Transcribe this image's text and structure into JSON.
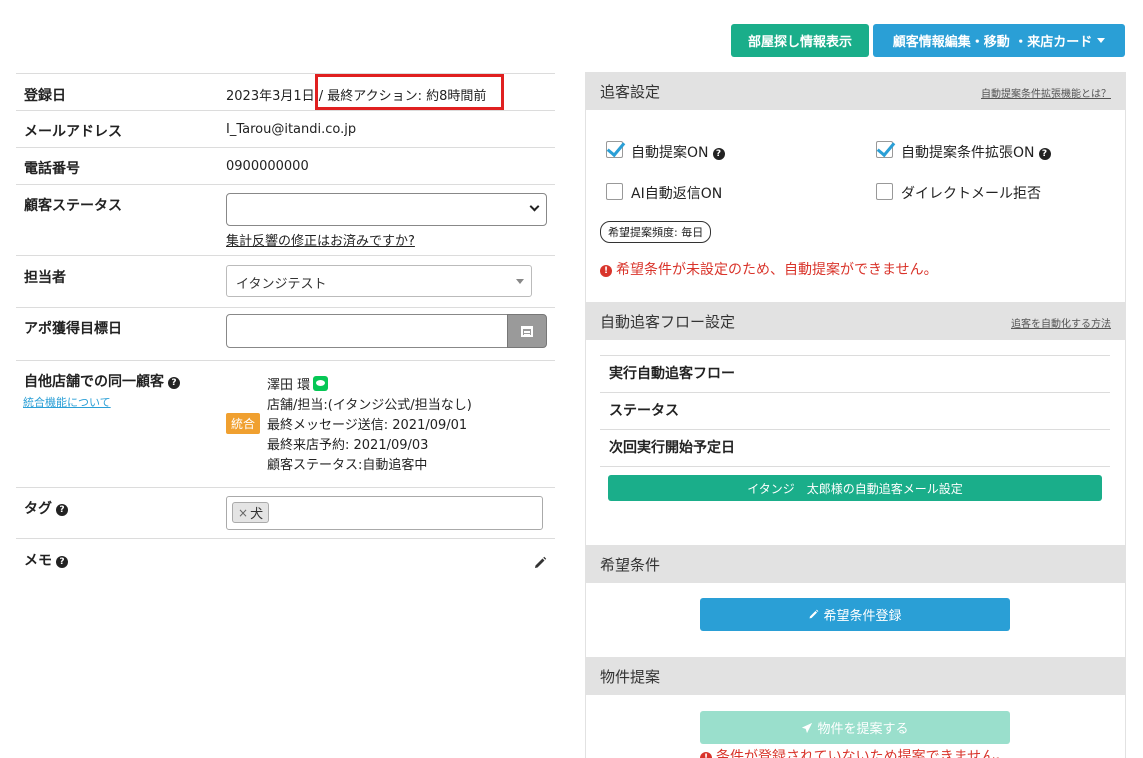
{
  "toolbar": {
    "room_search_label": "部屋探し情報表示",
    "customer_edit_label": "顧客情報編集・移動 ・来店カード"
  },
  "customer": {
    "registered_label": "登録日",
    "registered_value": "2023年3月1日 / 最終アクション: 約8時間前",
    "email_label": "メールアドレス",
    "email_value": "I_Tarou@itandi.co.jp",
    "phone_label": "電話番号",
    "phone_value": "0900000000",
    "status_label": "顧客ステータス",
    "status_value": "",
    "status_link": "集計反響の修正はお済みですか?",
    "staff_label": "担当者",
    "staff_value": "イタンジテスト",
    "appt_label": "アポ獲得目標日",
    "appt_value": "",
    "same_customer_label": "自他店舗での同一顧客",
    "merge_link": "統合機能について",
    "merge_badge": "統合",
    "same_customer": {
      "name": "澤田 環",
      "store": "店舗/担当:(イタンジ公式/担当なし)",
      "last_message": "最終メッセージ送信: 2021/09/01",
      "last_visit": "最終来店予約: 2021/09/03",
      "status": "顧客ステータス:自動追客中"
    },
    "tag_label": "タグ",
    "tags": [
      "犬"
    ],
    "memo_label": "メモ"
  },
  "followup": {
    "title": "追客設定",
    "help_link": "自動提案条件拡張機能とは？",
    "auto_suggest_label": "自動提案ON",
    "auto_suggest_checked": true,
    "auto_suggest_ext_label": "自動提案条件拡張ON",
    "auto_suggest_ext_checked": true,
    "ai_reply_label": "AI自動返信ON",
    "ai_reply_checked": false,
    "dm_reject_label": "ダイレクトメール拒否",
    "dm_reject_checked": false,
    "frequency_pill": "希望提案頻度: 毎日",
    "error": "希望条件が未設定のため、自動提案ができません。"
  },
  "auto_flow": {
    "title": "自動追客フロー設定",
    "help_link": "追客を自動化する方法",
    "rows": [
      "実行自動追客フロー",
      "ステータス",
      "次回実行開始予定日"
    ],
    "button_label": "イタンジ　太郎様の自動追客メール設定"
  },
  "conditions": {
    "title": "希望条件",
    "button_label": "希望条件登録"
  },
  "proposal": {
    "title": "物件提案",
    "button_label": "物件を提案する",
    "error": "条件が登録されていないため提案できません。"
  },
  "colors": {
    "green": "#1aae8a",
    "blue": "#2a9fd6",
    "error_red": "#d9342b",
    "highlight_red": "#e02020"
  }
}
